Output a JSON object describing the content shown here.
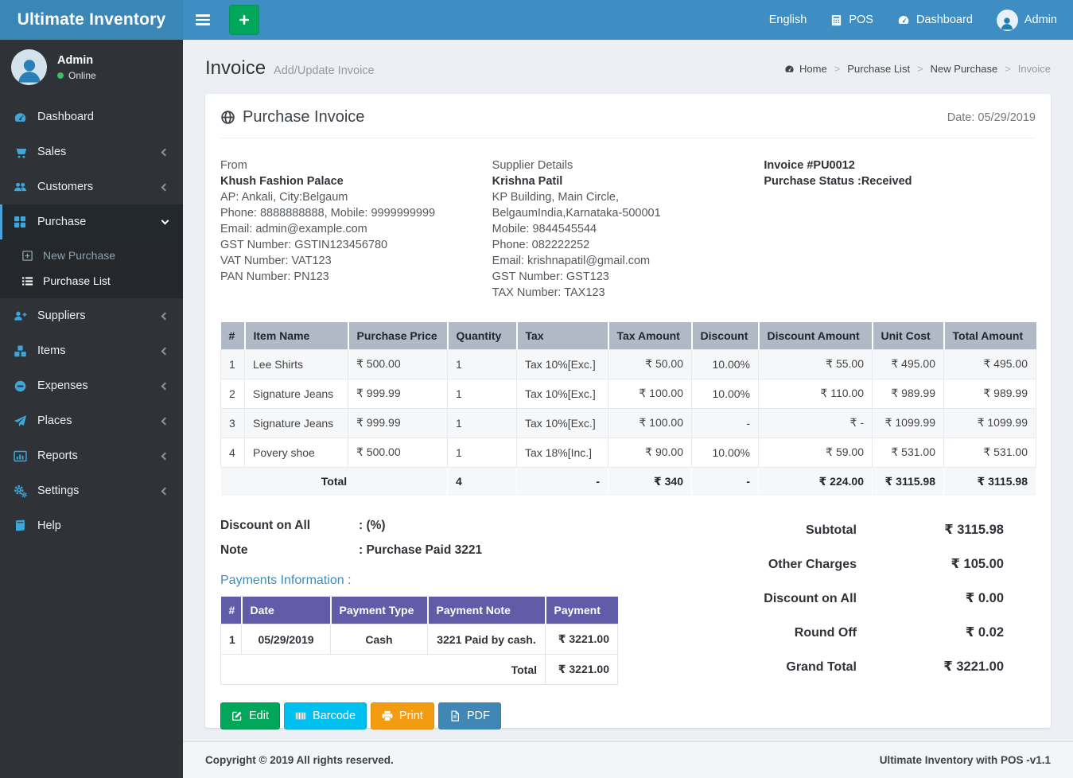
{
  "app": {
    "title": "Ultimate Inventory",
    "nav": {
      "language": "English",
      "pos": "POS",
      "dashboard": "Dashboard",
      "user": "Admin"
    }
  },
  "user_panel": {
    "name": "Admin",
    "status": "Online"
  },
  "sidebar": {
    "dashboard": "Dashboard",
    "sales": "Sales",
    "customers": "Customers",
    "purchase": "Purchase",
    "new_purchase": "New Purchase",
    "purchase_list": "Purchase List",
    "suppliers": "Suppliers",
    "items": "Items",
    "expenses": "Expenses",
    "places": "Places",
    "reports": "Reports",
    "settings": "Settings",
    "help": "Help"
  },
  "page": {
    "title": "Invoice",
    "subtitle": "Add/Update Invoice",
    "breadcrumb": {
      "home": "Home",
      "level1": "Purchase List",
      "level2": "New Purchase",
      "active": "Invoice"
    }
  },
  "invoice": {
    "title": "Purchase Invoice",
    "date": "Date: 05/29/2019",
    "from": {
      "heading": "From",
      "name": "Khush Fashion Palace",
      "address": "AP: Ankali, City:Belgaum",
      "phone": "Phone: 8888888888, Mobile: 9999999999",
      "email": "Email: admin@example.com",
      "gst": "GST Number: GSTIN123456780",
      "vat": "VAT Number: VAT123",
      "pan": "PAN Number: PN123"
    },
    "supplier": {
      "heading": "Supplier Details",
      "name": "Krishna Patil",
      "address": "KP Building, Main Circle, BelgaumIndia,Karnataka-500001",
      "mobile": "Mobile: 9844545544",
      "phone": "Phone: 082222252",
      "email": "Email: krishnapatil@gmail.com",
      "gst": "GST Number: GST123",
      "tax": "TAX Number: TAX123"
    },
    "meta": {
      "number": "Invoice #PU0012",
      "status": "Purchase Status :Received"
    },
    "items_table": {
      "headers": [
        "#",
        "Item Name",
        "Purchase Price",
        "Quantity",
        "Tax",
        "Tax Amount",
        "Discount",
        "Discount Amount",
        "Unit Cost",
        "Total Amount"
      ],
      "rows": [
        [
          "1",
          "Lee Shirts",
          "₹ 500.00",
          "1",
          "Tax 10%[Exc.]",
          "₹ 50.00",
          "10.00%",
          "₹ 55.00",
          "₹ 495.00",
          "₹ 495.00"
        ],
        [
          "2",
          "Signature Jeans",
          "₹ 999.99",
          "1",
          "Tax 10%[Exc.]",
          "₹ 100.00",
          "10.00%",
          "₹ 110.00",
          "₹ 989.99",
          "₹ 989.99"
        ],
        [
          "3",
          "Signature Jeans",
          "₹ 999.99",
          "1",
          "Tax 10%[Exc.]",
          "₹ 100.00",
          "-",
          "₹ -",
          "₹ 1099.99",
          "₹ 1099.99"
        ],
        [
          "4",
          "Povery shoe",
          "₹ 500.00",
          "1",
          "Tax 18%[Inc.]",
          "₹ 90.00",
          "10.00%",
          "₹ 59.00",
          "₹ 531.00",
          "₹ 531.00"
        ]
      ],
      "total_row": {
        "label": "Total",
        "quantity": "4",
        "tax": "-",
        "tax_amount": "₹ 340",
        "discount": "-",
        "discount_amount": "₹ 224.00",
        "unit_cost": "₹ 3115.98",
        "total_amount": "₹ 3115.98"
      }
    },
    "discount_on_all": {
      "label": "Discount on All",
      "value": ": (%)"
    },
    "note": {
      "label": "Note",
      "value": ": Purchase Paid 3221"
    },
    "payments": {
      "heading": "Payments Information :",
      "headers": [
        "#",
        "Date",
        "Payment Type",
        "Payment Note",
        "Payment"
      ],
      "rows": [
        [
          "1",
          "05/29/2019",
          "Cash",
          "3221 Paid by cash.",
          "₹ 3221.00"
        ]
      ],
      "total_label": "Total",
      "total_value": "₹ 3221.00"
    },
    "summary": {
      "subtotal_label": "Subtotal",
      "subtotal": "₹ 3115.98",
      "other_label": "Other Charges",
      "other": "₹ 105.00",
      "discount_label": "Discount on All",
      "discount": "₹ 0.00",
      "round_label": "Round Off",
      "round": "₹ 0.02",
      "grand_label": "Grand Total",
      "grand": "₹ 3221.00"
    },
    "actions": {
      "edit": "Edit",
      "barcode": "Barcode",
      "print": "Print",
      "pdf": "PDF"
    }
  },
  "footer": {
    "left": "Copyright © 2019 All rights reserved.",
    "right": "Ultimate Inventory with POS -v1.1"
  },
  "colors": {
    "navbar": "#3f8ec3",
    "logo_bg": "#3a86b7",
    "sidebar_bg": "#2f3338",
    "sidebar_icon": "#3da7dc",
    "active_border": "#4aa3d8",
    "items_header_bg": "#b1b8c6",
    "items_total_bg": "#c9ced9",
    "payments_header_bg": "#605ca8",
    "online_dot": "#3dbd64",
    "btn_edit": "#00a65a",
    "btn_barcode": "#00c0ef",
    "btn_print": "#f39c12",
    "btn_pdf": "#4187b5"
  }
}
